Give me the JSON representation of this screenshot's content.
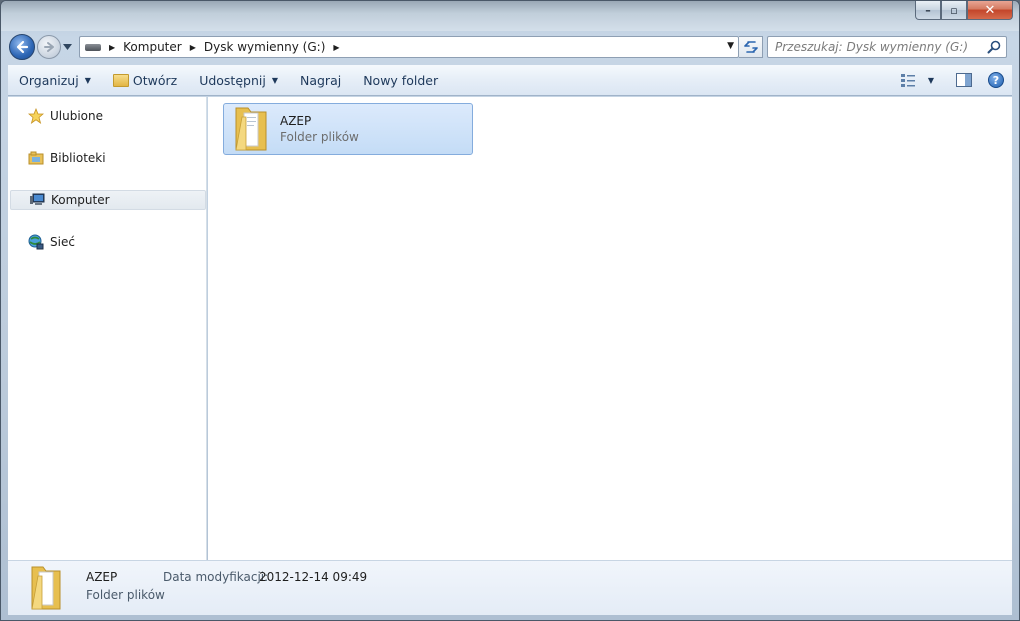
{
  "window": {
    "caption_minimize": "–",
    "caption_maximize": "▫",
    "caption_close": "✕"
  },
  "address_bar": {
    "crumbs": [
      "Komputer",
      "Dysk wymienny (G:)"
    ],
    "search_placeholder": "Przeszukaj: Dysk wymienny (G:)"
  },
  "command_bar": {
    "organize": "Organizuj",
    "open": "Otwórz",
    "share": "Udostępnij",
    "burn": "Nagraj",
    "new_folder": "Nowy folder"
  },
  "nav_pane": {
    "items": [
      {
        "label": "Ulubione",
        "icon": "star-icon"
      },
      {
        "label": "Biblioteki",
        "icon": "libraries-icon"
      },
      {
        "label": "Komputer",
        "icon": "computer-icon",
        "selected": true
      },
      {
        "label": "Sieć",
        "icon": "network-icon"
      }
    ]
  },
  "content": {
    "items": [
      {
        "name": "AZEP",
        "type": "Folder plików",
        "selected": true
      }
    ]
  },
  "details": {
    "name": "AZEP",
    "type": "Folder plików",
    "modified_label": "Data modyfikacji:",
    "modified_value": "2012-12-14 09:49"
  }
}
